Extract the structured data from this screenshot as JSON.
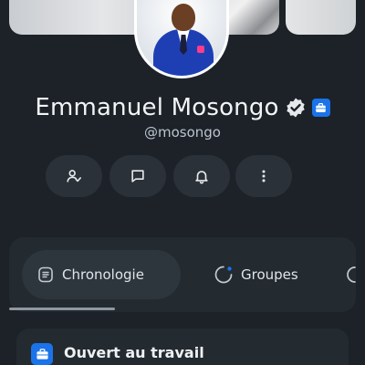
{
  "profile": {
    "name": "Emmanuel Mosongo",
    "handle": "@mosongo"
  },
  "tabs": [
    {
      "label": "Chronologie",
      "active": true
    },
    {
      "label": "Groupes",
      "active": false
    }
  ],
  "open_to_work": {
    "title": "Ouvert au travail"
  },
  "colors": {
    "background": "#1c2228",
    "card": "#232a30",
    "accent": "#1a73e8"
  }
}
